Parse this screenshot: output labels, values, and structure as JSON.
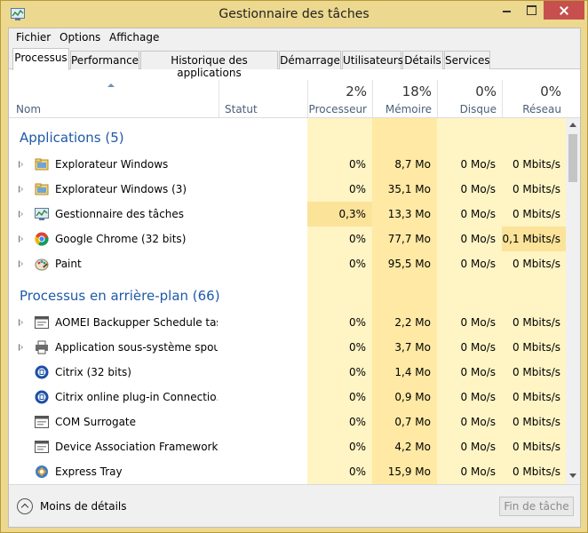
{
  "window": {
    "title": "Gestionnaire des tâches"
  },
  "menu": {
    "fichier": "Fichier",
    "options": "Options",
    "affichage": "Affichage"
  },
  "tabs": [
    "Processus",
    "Performance",
    "Historique des applications",
    "Démarrage",
    "Utilisateurs",
    "Détails",
    "Services"
  ],
  "active_tab": "Processus",
  "columns": {
    "nom": "Nom",
    "statut": "Statut",
    "cpu": {
      "pct": "2%",
      "label": "Processeur"
    },
    "mem": {
      "pct": "18%",
      "label": "Mémoire"
    },
    "disk": {
      "pct": "0%",
      "label": "Disque"
    },
    "net": {
      "pct": "0%",
      "label": "Réseau"
    }
  },
  "groups": {
    "apps": {
      "title": "Applications (5)",
      "rows": [
        {
          "name": "Explorateur Windows",
          "icon": "folder-icon",
          "cpu": "0%",
          "mem": "8,7 Mo",
          "disk": "0 Mo/s",
          "net": "0 Mbits/s"
        },
        {
          "name": "Explorateur Windows (3)",
          "icon": "folder-icon",
          "cpu": "0%",
          "mem": "35,1 Mo",
          "disk": "0 Mo/s",
          "net": "0 Mbits/s"
        },
        {
          "name": "Gestionnaire des tâches",
          "icon": "task-manager-icon",
          "cpu": "0,3%",
          "mem": "13,3 Mo",
          "disk": "0 Mo/s",
          "net": "0 Mbits/s"
        },
        {
          "name": "Google Chrome (32 bits)",
          "icon": "chrome-icon",
          "cpu": "0%",
          "mem": "77,7 Mo",
          "disk": "0 Mo/s",
          "net": "0,1 Mbits/s"
        },
        {
          "name": "Paint",
          "icon": "paint-icon",
          "cpu": "0%",
          "mem": "95,5 Mo",
          "disk": "0 Mo/s",
          "net": "0 Mbits/s"
        }
      ]
    },
    "background": {
      "title": "Processus en arrière-plan (66)",
      "rows": [
        {
          "name": "AOMEI Backupper Schedule tas...",
          "icon": "service-window-icon",
          "cpu": "0%",
          "mem": "2,2 Mo",
          "disk": "0 Mo/s",
          "net": "0 Mbits/s"
        },
        {
          "name": "Application sous-système spoul...",
          "icon": "printer-icon",
          "cpu": "0%",
          "mem": "3,7 Mo",
          "disk": "0 Mo/s",
          "net": "0 Mbits/s"
        },
        {
          "name": "Citrix (32 bits)",
          "icon": "citrix-icon",
          "cpu": "0%",
          "mem": "1,4 Mo",
          "disk": "0 Mo/s",
          "net": "0 Mbits/s"
        },
        {
          "name": "Citrix online plug-in Connectio...",
          "icon": "citrix-icon",
          "cpu": "0%",
          "mem": "0,9 Mo",
          "disk": "0 Mo/s",
          "net": "0 Mbits/s"
        },
        {
          "name": "COM Surrogate",
          "icon": "service-window-icon",
          "cpu": "0%",
          "mem": "0,7 Mo",
          "disk": "0 Mo/s",
          "net": "0 Mbits/s"
        },
        {
          "name": "Device Association Framework ...",
          "icon": "service-window-icon",
          "cpu": "0%",
          "mem": "4,2 Mo",
          "disk": "0 Mo/s",
          "net": "0 Mbits/s"
        },
        {
          "name": "Express Tray",
          "icon": "express-tray-icon",
          "cpu": "0%",
          "mem": "15,9 Mo",
          "disk": "0 Mo/s",
          "net": "0 Mbits/s"
        }
      ]
    }
  },
  "footer": {
    "less_details": "Moins de détails",
    "end_task": "Fin de tâche"
  },
  "colors": {
    "heat_light": "#fff4c4",
    "heat_med": "#ffe9a4",
    "heat_strong": "#fbe39a",
    "group_title": "#1e5aa8",
    "title_bar": "#ecd88e",
    "close_button": "#c7504f"
  }
}
